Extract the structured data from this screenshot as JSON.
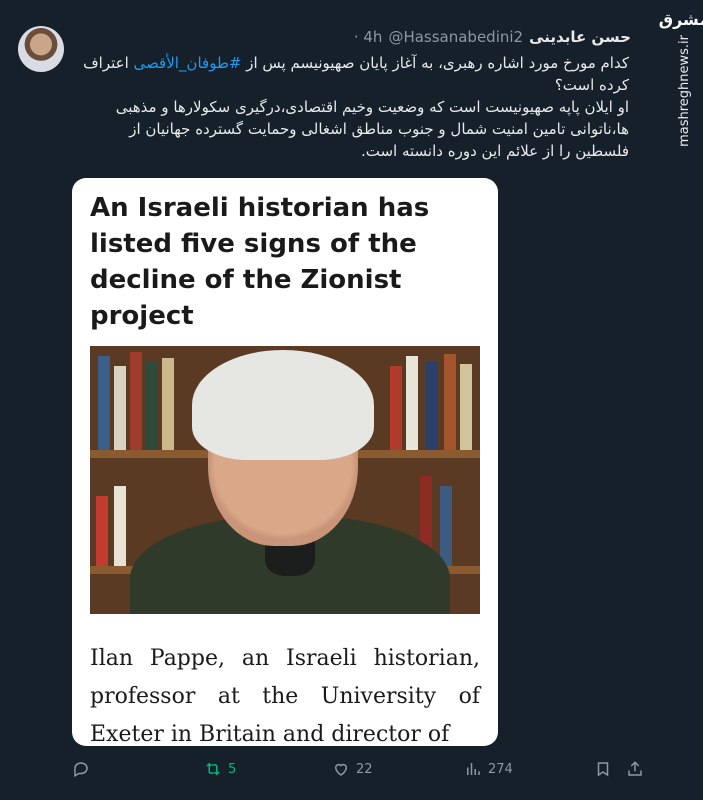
{
  "tweet": {
    "author_name": "حسن عابدینی",
    "handle": "@Hassanabedini2",
    "time_label": "· 4h",
    "text_line1_before": "کدام مورخ مورد اشاره رهبری، به آغاز پایان صهیونیسم پس از ",
    "hashtag": "#طوفان_الأقصی",
    "text_line1_after": " اعتراف کرده است؟",
    "text_line2": "او ایلان پاپه صهیونیست است که وضعیت وخیم اقتصادی،درگیری سکولارها و مذهبی ها،ناتوانی تامین امنیت شمال و جنوب مناطق اشغالی وحمایت گسترده جهانیان از فلسطین را از علائم این دوره دانسته است."
  },
  "card": {
    "headline": "An Israeli historian has listed five signs of the decline of the Zionist project",
    "body_text": "Ilan Pappe, an Israeli historian, professor at the University of Exeter in Britain and director of"
  },
  "watermark": {
    "logo": "مشرق",
    "site": "mashreghnews.ir"
  },
  "actions": {
    "reply_count": "",
    "retweet_count": "5",
    "like_count": "22",
    "views_count": "274"
  },
  "colors": {
    "background": "#15202b",
    "accent": "#1d9bf0",
    "retweet": "#00ba7c",
    "muted": "#8b98a5"
  },
  "icons": [
    "reply-icon",
    "retweet-icon",
    "like-icon",
    "views-icon",
    "bookmark-icon",
    "share-icon"
  ]
}
